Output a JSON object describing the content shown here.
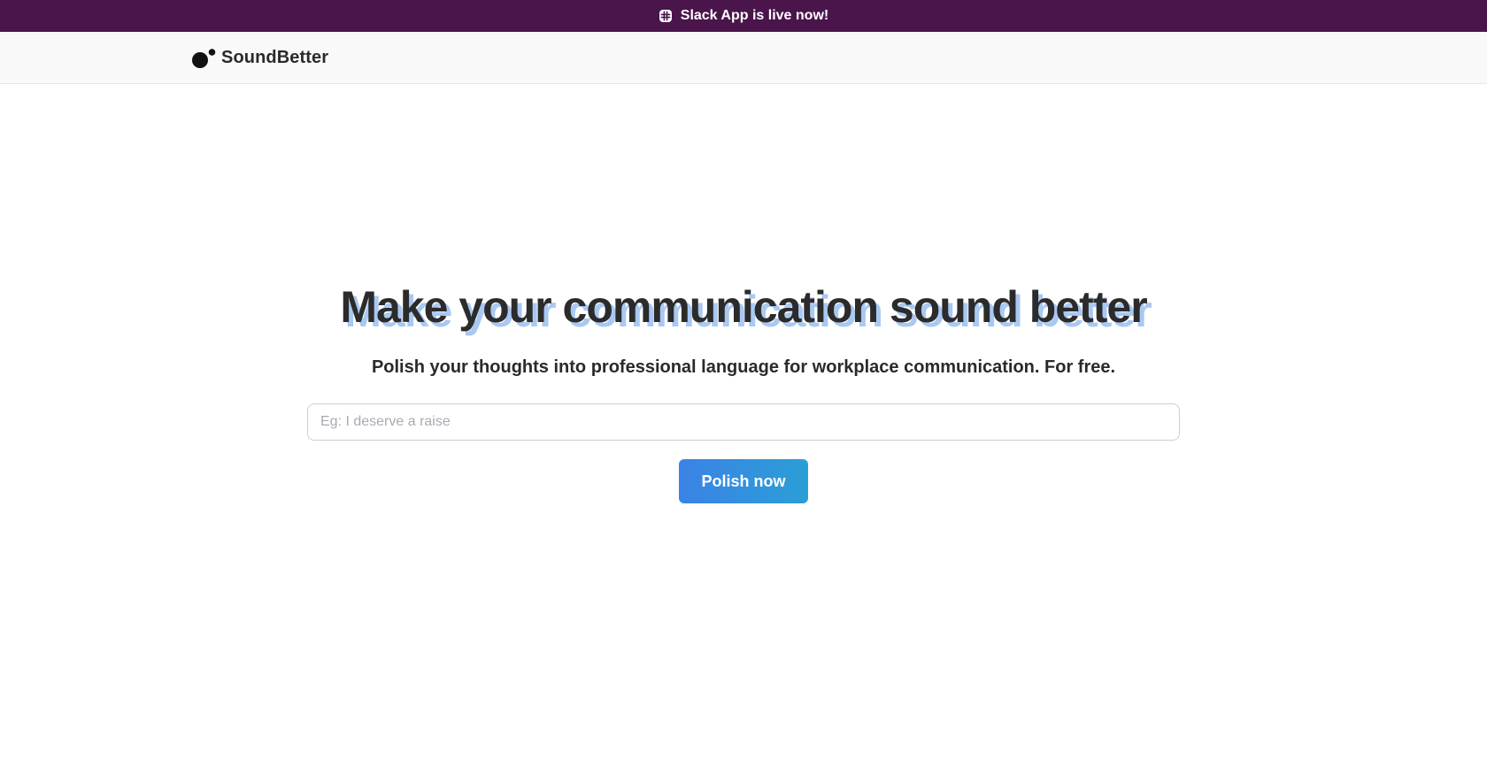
{
  "banner": {
    "icon": "slack-icon",
    "text": "Slack App is live now!",
    "background_color": "#4a154b"
  },
  "navbar": {
    "logo_icon": "soundbetter-logo-icon",
    "brand_name": "SoundBetter"
  },
  "hero": {
    "headline": "Make your communication sound better",
    "headline_shadow_color": "#a9c8f2",
    "subheadline": "Polish your thoughts into professional language for workplace communication. For free.",
    "input": {
      "value": "",
      "placeholder": "Eg: I deserve a raise"
    },
    "submit_label": "Polish now",
    "button_gradient": [
      "#3b82e6",
      "#2a9fd6"
    ]
  }
}
